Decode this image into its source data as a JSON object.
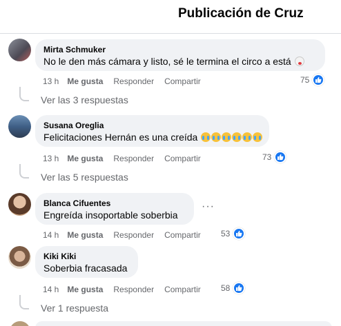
{
  "header": {
    "title": "Publicación de Cruz"
  },
  "comments": [
    {
      "author": "Mirta Schmuker",
      "text": "No le den más cámara y listo, sé le termina el circo a está",
      "emoji": "clown-face-emoji",
      "time": "13 h",
      "like_label": "Me gusta",
      "reply_label": "Responder",
      "share_label": "Compartir",
      "reactions": "75",
      "view_replies": "Ver las 3 respuestas"
    },
    {
      "author": "Susana Oreglia",
      "text": "Felicitaciones Hernán es una creída",
      "emoji": "crying-face-emoji x6",
      "time": "13 h",
      "like_label": "Me gusta",
      "reply_label": "Responder",
      "share_label": "Compartir",
      "reactions": "73",
      "view_replies": "Ver las 5 respuestas"
    },
    {
      "author": "Blanca Cifuentes",
      "text": "Engreída insoportable soberbia",
      "time": "14 h",
      "like_label": "Me gusta",
      "reply_label": "Responder",
      "share_label": "Compartir",
      "reactions": "53",
      "more_icon": "more-options-icon"
    },
    {
      "author": "Kiki Kiki",
      "text": "Soberbia fracasada",
      "time": "14 h",
      "like_label": "Me gusta",
      "reply_label": "Responder",
      "share_label": "Compartir",
      "reactions": "58",
      "view_replies": "Ver 1 respuesta"
    }
  ],
  "colors": {
    "like_blue": "#1877f2",
    "bubble_bg": "#f0f2f5",
    "meta_gray": "#65676b"
  }
}
